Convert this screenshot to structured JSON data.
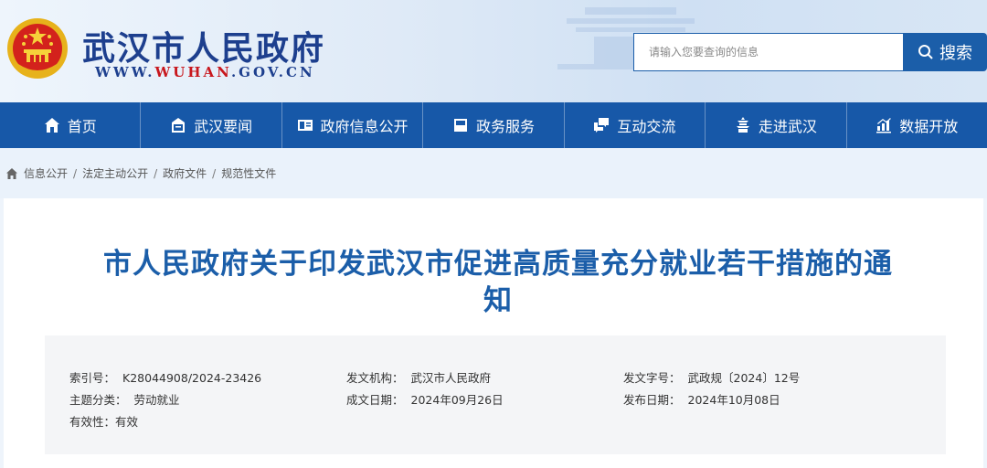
{
  "header": {
    "site_title": "武汉市人民政府",
    "url_prefix": "WWW.",
    "url_accent": "WUHAN",
    "url_suffix": ".GOV.CN",
    "search_placeholder": "请输入您要查询的信息",
    "search_label": "搜索",
    "brand_color": "#1d3f8e",
    "accent_color": "#c8171d"
  },
  "nav": {
    "items": [
      {
        "label": "首页",
        "icon": "home-icon"
      },
      {
        "label": "武汉要闻",
        "icon": "news-icon"
      },
      {
        "label": "政府信息公开",
        "icon": "info-card-icon"
      },
      {
        "label": "政务服务",
        "icon": "service-icon"
      },
      {
        "label": "互动交流",
        "icon": "chat-icon"
      },
      {
        "label": "走进武汉",
        "icon": "tower-icon"
      },
      {
        "label": "数据开放",
        "icon": "data-chart-icon"
      }
    ],
    "bg_color": "#1758a8"
  },
  "breadcrumb": {
    "items": [
      "信息公开",
      "法定主动公开",
      "政府文件",
      "规范性文件"
    ],
    "separator": "/"
  },
  "document": {
    "title": "市人民政府关于印发武汉市促进高质量充分就业若干措施的通知",
    "meta": {
      "index_no_label": "索引号：",
      "index_no": "K28044908/2024-23426",
      "issuer_label": "发文机构：",
      "issuer": "武汉市人民政府",
      "doc_no_label": "发文字号：",
      "doc_no": "武政规〔2024〕12号",
      "topic_label": "主题分类：",
      "topic": "劳动就业",
      "written_date_label": "成文日期：",
      "written_date": "2024年09月26日",
      "publish_date_label": "发布日期：",
      "publish_date": "2024年10月08日",
      "validity_label": "有效性：",
      "validity": "有效"
    }
  }
}
